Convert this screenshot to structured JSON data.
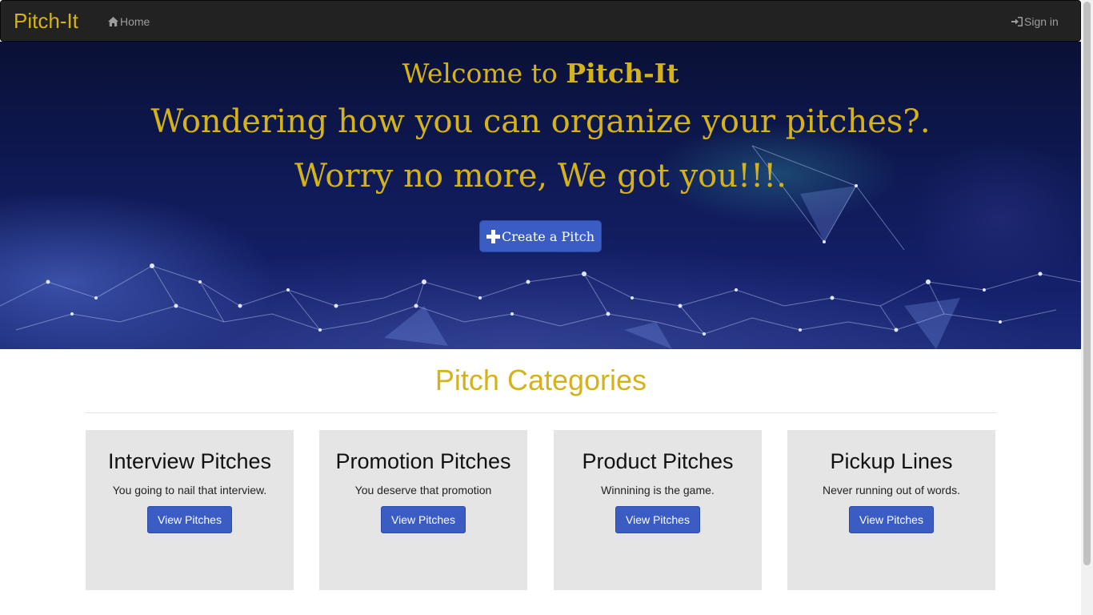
{
  "navbar": {
    "brand": "Pitch-It",
    "home_label": "Home",
    "signin_label": "Sign in",
    "home_icon": "home-icon",
    "signin_icon": "log-in-icon"
  },
  "hero": {
    "welcome_prefix": "Welcome to ",
    "welcome_brand": "Pitch-It",
    "line2": "Wondering how you can organize your pitches?.",
    "line3": "Worry no more, We got you!!!.",
    "create_button": "Create a Pitch",
    "create_icon": "plus-icon"
  },
  "categories": {
    "title": "Pitch Categories",
    "items": [
      {
        "title": "Interview Pitches",
        "text": "You going to nail that interview.",
        "button": "View Pitches"
      },
      {
        "title": "Promotion Pitches",
        "text": "You deserve that promotion",
        "button": "View Pitches"
      },
      {
        "title": "Product Pitches",
        "text": "Winnining is the game.",
        "button": "View Pitches"
      },
      {
        "title": "Pickup Lines",
        "text": "Never running out of words.",
        "button": "View Pitches"
      }
    ]
  },
  "colors": {
    "accent_gold": "#d4b21a",
    "button_blue": "#3a5cc3",
    "navbar_bg": "#222222",
    "card_bg": "#e5e5e5"
  }
}
